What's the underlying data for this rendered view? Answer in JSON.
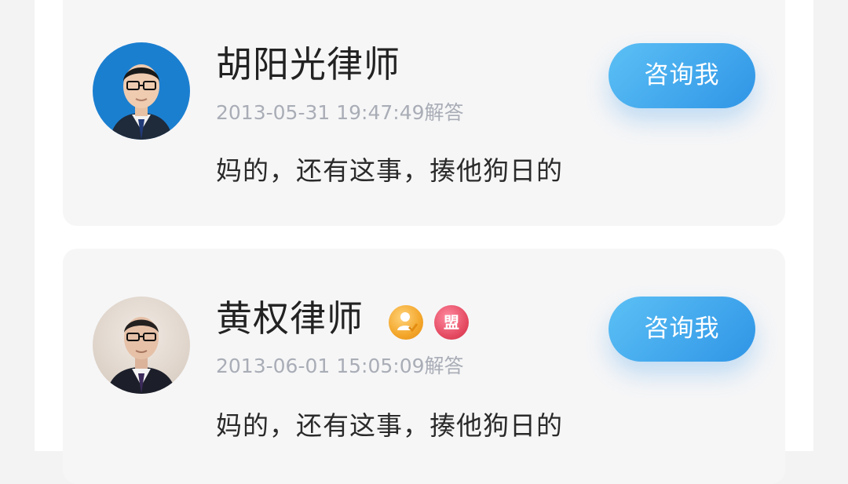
{
  "answers": [
    {
      "lawyer_name": "胡阳光律师",
      "answered_at": "2013-05-31 19:47:49解答",
      "content": "妈的，还有这事，揍他狗日的",
      "consult_label": "咨询我",
      "badges": []
    },
    {
      "lawyer_name": "黄权律师",
      "answered_at": "2013-06-01 15:05:09解答",
      "content": "妈的，还有这事，揍他狗日的",
      "consult_label": "咨询我",
      "badges": [
        {
          "icon": "verified-lawyer-icon",
          "color": "#f3a62a"
        },
        {
          "icon": "alliance-badge",
          "label": "盟",
          "color": "#e3485f"
        }
      ]
    }
  ]
}
